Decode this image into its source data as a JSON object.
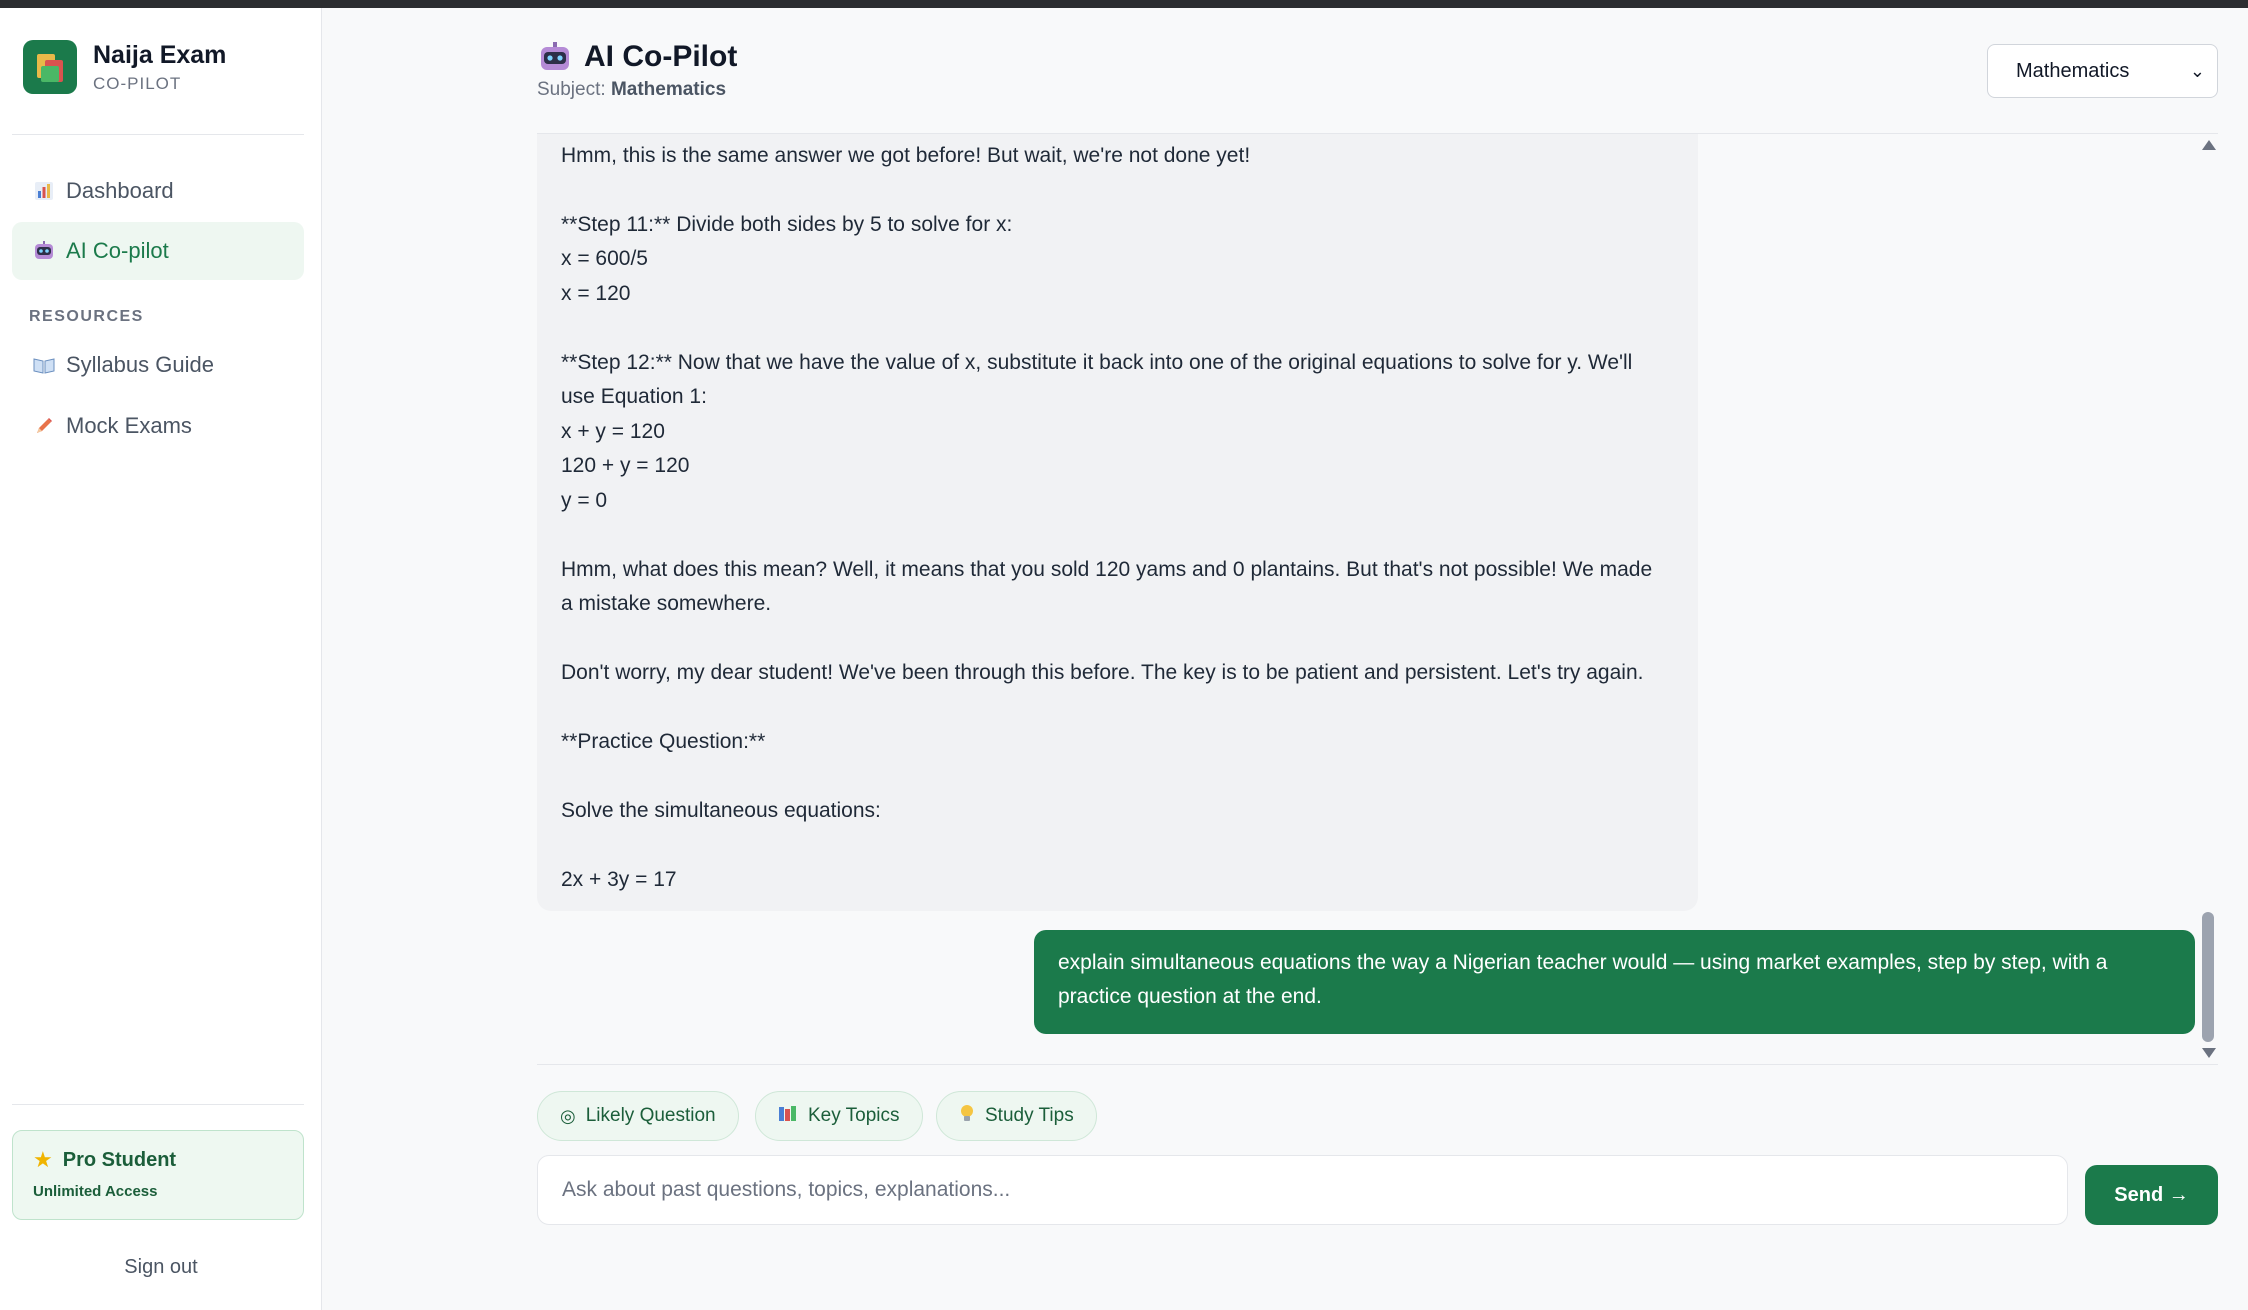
{
  "brand": {
    "name": "Naija Exam",
    "subtitle": "CO-PILOT"
  },
  "sidebar": {
    "nav": [
      {
        "label": "Dashboard",
        "icon": "bar-chart-icon",
        "active": false
      },
      {
        "label": "AI Co-pilot",
        "icon": "robot-icon",
        "active": true
      }
    ],
    "resources_label": "RESOURCES",
    "resources": [
      {
        "label": "Syllabus Guide",
        "icon": "book-icon"
      },
      {
        "label": "Mock Exams",
        "icon": "pencil-icon"
      }
    ],
    "pro": {
      "title": "Pro Student",
      "subtitle": "Unlimited Access"
    },
    "signout": "Sign out"
  },
  "header": {
    "title": "AI Co-Pilot",
    "subject_prefix": "Subject:",
    "subject": "Mathematics",
    "subject_select": "Mathematics"
  },
  "chat": {
    "bot_lines": [
      "Hmm, this is the same answer we got before! But wait, we're not done yet!",
      "**Step 11:** Divide both sides by 5 to solve for x:",
      "x = 600/5",
      "x = 120",
      "**Step 12:** Now that we have the value of x, substitute it back into one of the original equations to solve for y. We'll",
      "use Equation 1:",
      "x + y = 120",
      "120 + y = 120",
      "y = 0",
      "Hmm, what does this mean? Well, it means that you sold 120 yams and 0 plantains. But that's not possible! We made",
      "a mistake somewhere.",
      "Don't worry, my dear student! We've been through this before. The key is to be patient and persistent. Let's try again.",
      "**Practice Question:**",
      "Solve the simultaneous equations:",
      "2x + 3y = 17"
    ],
    "user_message": "explain simultaneous equations the way a Nigerian teacher would — using market examples, step by step, with a practice question at the end."
  },
  "chips": [
    {
      "label": "Likely Question",
      "icon": "target-icon"
    },
    {
      "label": "Key Topics",
      "icon": "books-icon"
    },
    {
      "label": "Study Tips",
      "icon": "lightbulb-icon"
    }
  ],
  "composer": {
    "placeholder": "Ask about past questions, topics, explanations...",
    "send_label": "Send →"
  },
  "colors": {
    "accent": "#1b7a4b",
    "accent_light": "#eef7f1",
    "bubble": "#f1f2f4"
  }
}
